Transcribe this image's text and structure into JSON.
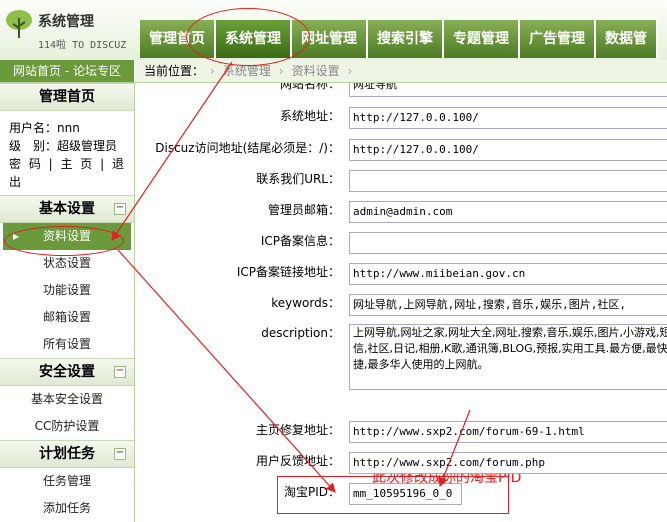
{
  "header": {
    "title": "系统管理",
    "subtitle": "114啦 TO DISCUZ",
    "tabs": [
      "管理首页",
      "系统管理",
      "网址管理",
      "搜索引擎",
      "专题管理",
      "广告管理",
      "数据管"
    ]
  },
  "breadcrumb": {
    "site_link": "网站首页 - 论坛专区",
    "label": "当前位置：",
    "items": [
      "系统管理",
      "资料设置"
    ]
  },
  "sidebar": {
    "home_header": "管理首页",
    "username_label": "用户名：nnn",
    "level_label": "级　别：超级管理员",
    "links": "密 码 | 主 页 | 退 出",
    "sections": [
      {
        "title": "基本设置",
        "toggle": "−",
        "items": [
          "资料设置",
          "状态设置",
          "功能设置",
          "邮箱设置",
          "所有设置"
        ]
      },
      {
        "title": "安全设置",
        "toggle": "−",
        "items": [
          "基本安全设置",
          "CC防护设置"
        ]
      },
      {
        "title": "计划任务",
        "toggle": "−",
        "items": [
          "任务管理",
          "添加任务"
        ]
      }
    ]
  },
  "form": {
    "partial_label": "网站名称：",
    "partial_value": "网址导航",
    "fields": [
      {
        "label": "系统地址：",
        "value": "http://127.0.0.100/"
      },
      {
        "label": "Discuz访问地址(结尾必须是：/)：",
        "value": "http://127.0.0.100/"
      },
      {
        "label": "联系我们URL：",
        "value": ""
      },
      {
        "label": "管理员邮箱：",
        "value": "admin@admin.com"
      },
      {
        "label": "ICP备案信息：",
        "value": ""
      },
      {
        "label": "ICP备案链接地址：",
        "value": "http://www.miibeian.gov.cn"
      },
      {
        "label": "keywords：",
        "value": "网址导航,上网导航,网址,搜索,音乐,娱乐,图片,社区,"
      },
      {
        "label": "description：",
        "value": "上网导航,网址之家,网址大全,网址,搜索,音乐,娱乐,图片,小游戏,短信,社区,日记,相册,K歌,通讯簿,BLOG,预报,实用工具.最方便,最快捷,最多华人使用的上网航。"
      },
      {
        "label": "主页修复地址：",
        "value": "http://www.sxp2.com/forum-69-1.html"
      },
      {
        "label": "用户反馈地址：",
        "value": "http://www.sxp2.com/forum.php"
      },
      {
        "label": "淘宝PID：",
        "value": "mm_10595196_0_0"
      }
    ]
  },
  "annotation": {
    "text": "此次修改成你的淘宝PID",
    "color": "#e02020"
  }
}
